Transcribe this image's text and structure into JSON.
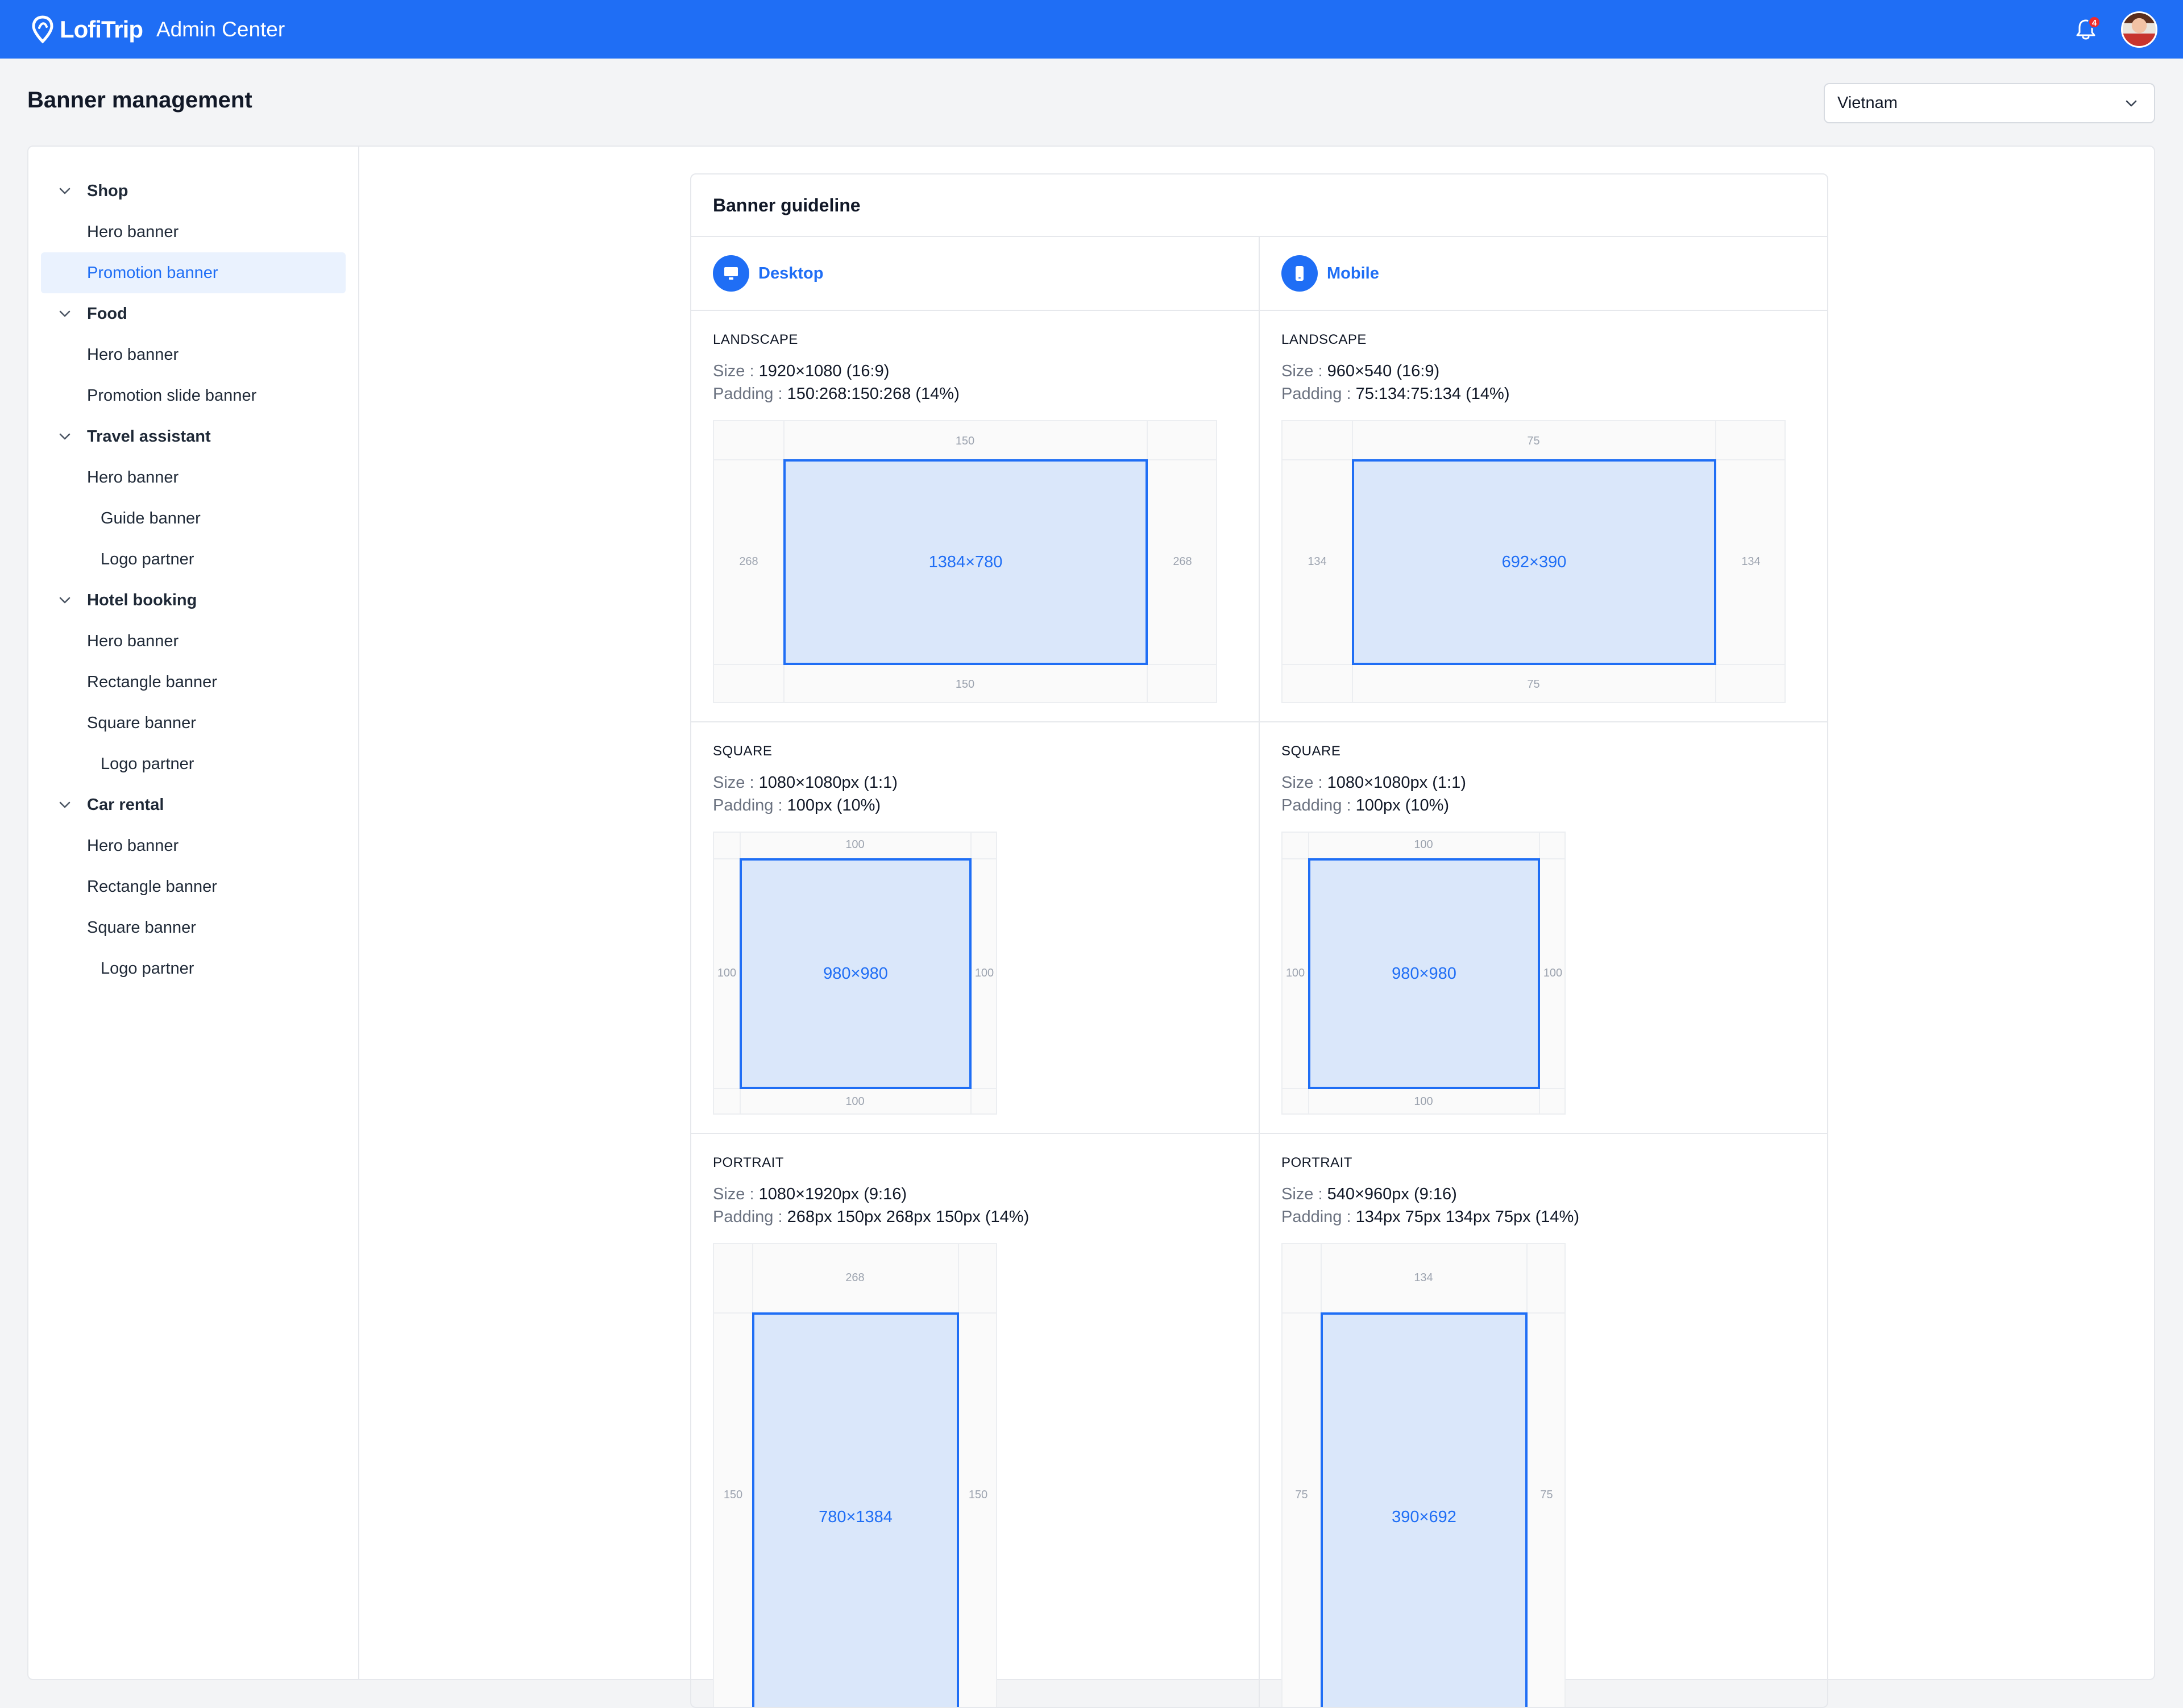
{
  "header": {
    "brand": "LofiTrip",
    "subtitle": "Admin Center",
    "notification_count": "4",
    "accent_color": "#1f6ef5"
  },
  "page": {
    "title": "Banner management",
    "country": "Vietnam"
  },
  "sidebar": {
    "groups": [
      {
        "label": "Shop",
        "items": [
          {
            "label": "Hero banner"
          },
          {
            "label": "Promotion banner",
            "active": true
          }
        ]
      },
      {
        "label": "Food",
        "items": [
          {
            "label": "Hero banner"
          },
          {
            "label": "Promotion slide banner"
          }
        ]
      },
      {
        "label": "Travel assistant",
        "items": [
          {
            "label": "Hero banner"
          },
          {
            "label": "Guide banner"
          },
          {
            "label": "Logo partner"
          }
        ]
      },
      {
        "label": "Hotel booking",
        "items": [
          {
            "label": "Hero banner"
          },
          {
            "label": "Rectangle banner"
          },
          {
            "label": "Square banner"
          },
          {
            "label": "Logo partner"
          }
        ]
      },
      {
        "label": "Car rental",
        "items": [
          {
            "label": "Hero banner"
          },
          {
            "label": "Rectangle banner"
          },
          {
            "label": "Square banner"
          },
          {
            "label": "Logo partner"
          }
        ]
      }
    ]
  },
  "guide": {
    "title": "Banner guideline",
    "size_key": "Size :",
    "padding_key": "Padding :",
    "desktop": {
      "label": "Desktop",
      "landscape": {
        "title": "LANDSCAPE",
        "size": "1920×1080 (16:9)",
        "padding": "150:268:150:268 (14%)",
        "inner": "1384×780",
        "top": "150",
        "bottom": "150",
        "left": "268",
        "right": "268"
      },
      "square": {
        "title": "SQUARE",
        "size": "1080×1080px (1:1)",
        "padding": "100px (10%)",
        "inner": "980×980",
        "top": "100",
        "bottom": "100",
        "left": "100",
        "right": "100"
      },
      "portrait": {
        "title": "PORTRAIT",
        "size": "1080×1920px (9:16)",
        "padding": "268px 150px 268px 150px (14%)",
        "inner": "780×1384",
        "top": "268",
        "left": "150",
        "right": "150"
      }
    },
    "mobile": {
      "label": "Mobile",
      "landscape": {
        "title": "LANDSCAPE",
        "size": "960×540 (16:9)",
        "padding": "75:134:75:134 (14%)",
        "inner": "692×390",
        "top": "75",
        "bottom": "75",
        "left": "134",
        "right": "134"
      },
      "square": {
        "title": "SQUARE",
        "size": "1080×1080px (1:1)",
        "padding": "100px (10%)",
        "inner": "980×980",
        "top": "100",
        "bottom": "100",
        "left": "100",
        "right": "100"
      },
      "portrait": {
        "title": "PORTRAIT",
        "size": "540×960px (9:16)",
        "padding": "134px 75px 134px 75px (14%)",
        "inner": "390×692",
        "top": "134",
        "left": "75",
        "right": "75"
      }
    }
  }
}
